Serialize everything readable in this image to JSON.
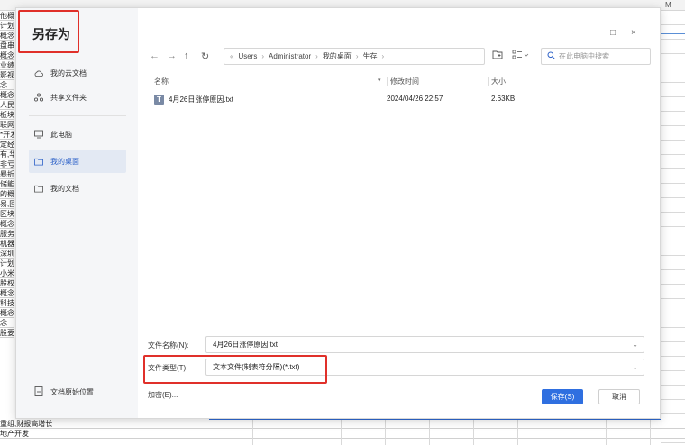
{
  "sheet": {
    "column_m": "M",
    "left_cells": [
      "他概念",
      "计划,",
      "概念,",
      "盘串",
      "概念",
      "业绩",
      "影视",
      "念",
      "概念,",
      "人民",
      "板块,",
      "联网,",
      "*开发",
      "定经济",
      "有,华",
      "非亏损",
      "暴折",
      "储能",
      "的概念",
      "易,回",
      "区块",
      "概念",
      "服务,",
      "机器人",
      "深圳",
      "计划,",
      "小米",
      "股权",
      "概念",
      "科技,",
      "概念",
      "念",
      "股要素"
    ],
    "bottom_rows": [
      "重组,财报高增长",
      "地产开发"
    ]
  },
  "dialog": {
    "title": "另存为",
    "window_controls": {
      "maximize": "□",
      "close": "×"
    },
    "sidebar": {
      "items": [
        {
          "label": "我的云文档",
          "icon": "cloud-icon"
        },
        {
          "label": "共享文件夹",
          "icon": "share-icon"
        },
        {
          "label": "此电脑",
          "icon": "monitor-icon"
        },
        {
          "label": "我的桌面",
          "icon": "folder-icon"
        },
        {
          "label": "我的文档",
          "icon": "folder-icon"
        }
      ],
      "bottom_item": {
        "label": "文档原始位置",
        "icon": "document-icon"
      }
    },
    "nav": {
      "back": "←",
      "forward": "→",
      "up": "↑",
      "refresh": "↻",
      "breadcrumb": [
        "Users",
        "Administrator",
        "我的桌面",
        "生存"
      ],
      "breadcrumb_prefix": "«",
      "search_placeholder": "在此电脑中搜索"
    },
    "columns": {
      "name": "名称",
      "modified": "修改时间",
      "size": "大小"
    },
    "files": [
      {
        "name": "4月26日涨停原因.txt",
        "modified": "2024/04/26 22:57",
        "size": "2.63KB",
        "icon": "T"
      }
    ],
    "filename_label": "文件名称(N):",
    "filename_value": "4月26日涨停原因.txt",
    "filetype_label": "文件类型(T):",
    "filetype_value": "文本文件(制表符分隔)(*.txt)",
    "encrypt_label": "加密(E)...",
    "save_label": "保存(S)",
    "cancel_label": "取消"
  },
  "colors": {
    "accent": "#2f6fe0",
    "highlight_box": "#e0302a",
    "active_sidebar": "#e3e9f3"
  }
}
